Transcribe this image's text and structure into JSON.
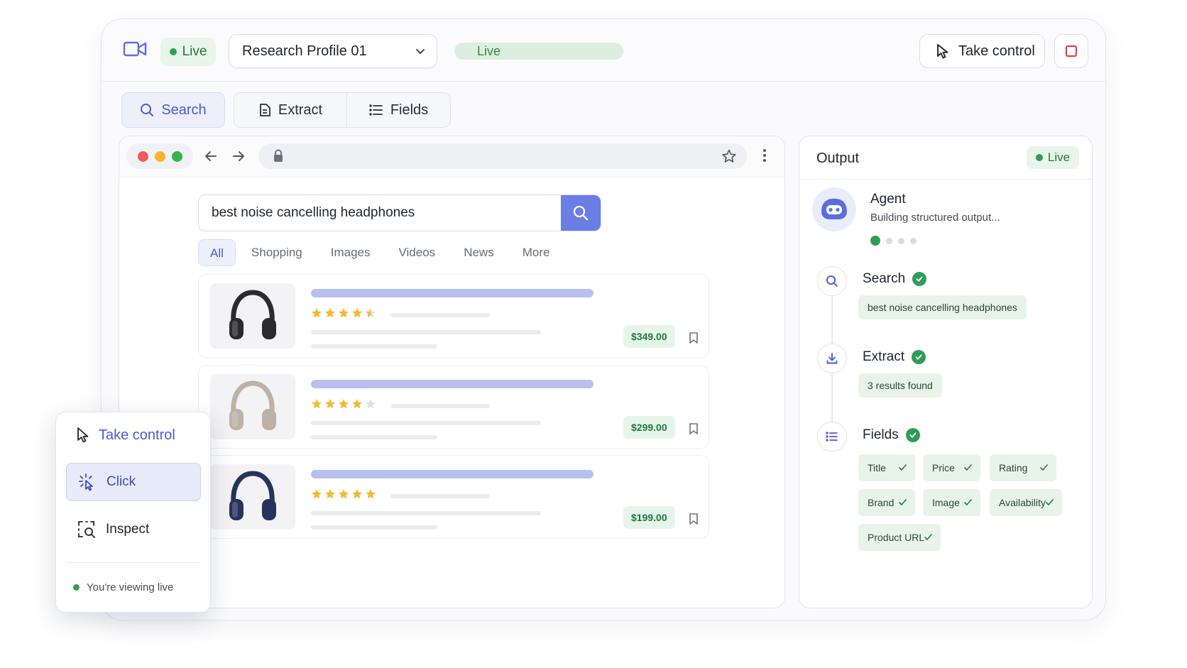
{
  "topbar": {
    "camera_icon": "video-camera-icon",
    "live_label": "Live",
    "profile": "Research Profile 01",
    "live_bar_label": "Live",
    "take_control": "Take control",
    "stop_icon": "stop-icon"
  },
  "tabs": [
    {
      "label": "Search",
      "icon": "search-icon"
    },
    {
      "label": "Extract",
      "icon": "document-icon"
    },
    {
      "label": "Fields",
      "icon": "list-icon"
    }
  ],
  "browser": {
    "search_query": "best noise cancelling headphones",
    "filters": [
      "All",
      "Shopping",
      "Images",
      "Videos",
      "News",
      "More"
    ],
    "results": [
      {
        "price": "$349.00",
        "rating": 4.5,
        "color": "#2b2b2e"
      },
      {
        "price": "$299.00",
        "rating": 4,
        "color": "#bdb2a3"
      },
      {
        "price": "$199.00",
        "rating": 5,
        "color": "#24345c"
      }
    ]
  },
  "output": {
    "title": "Output",
    "live_label": "Live",
    "agent": {
      "name": "Agent",
      "status": "Building structured output..."
    },
    "steps": {
      "search": {
        "title": "Search",
        "detail": "best noise cancelling headphones"
      },
      "extract": {
        "title": "Extract",
        "detail": "3 results found"
      },
      "fields": {
        "title": "Fields",
        "items": [
          "Title",
          "Price",
          "Rating",
          "Brand",
          "Image",
          "Availability",
          "Product URL"
        ]
      }
    }
  },
  "popover": {
    "take_control": "Take control",
    "click": "Click",
    "inspect": "Inspect",
    "status": "You're viewing live"
  },
  "colors": {
    "accent": "#4a5bd6",
    "live_green": "#2f9e55",
    "star_gold": "#f5b82e"
  }
}
